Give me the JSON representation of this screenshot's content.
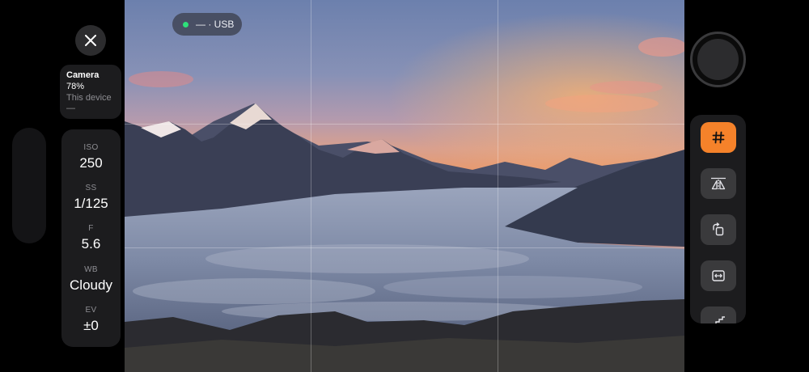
{
  "connection": {
    "dot_color": "#2ee07a",
    "label": "— · USB"
  },
  "device": {
    "name": "Camera",
    "battery": "78%",
    "source": "This device",
    "extra": "—"
  },
  "params": [
    {
      "label": "ISO",
      "value": "250"
    },
    {
      "label": "SS",
      "value": "1/125"
    },
    {
      "label": "F",
      "value": "5.6"
    },
    {
      "label": "WB",
      "value": "Cloudy"
    },
    {
      "label": "EV",
      "value": "±0"
    }
  ],
  "tools": [
    {
      "icon": "grid-icon",
      "active": true
    },
    {
      "icon": "perspective-icon",
      "active": false
    },
    {
      "icon": "rotate-icon",
      "active": false
    },
    {
      "icon": "fit-width-icon",
      "active": false
    },
    {
      "icon": "histogram-icon",
      "active": false
    }
  ],
  "colors": {
    "accent": "#f5822a",
    "panel": "#1c1c1e",
    "button": "#3a3a3c"
  }
}
